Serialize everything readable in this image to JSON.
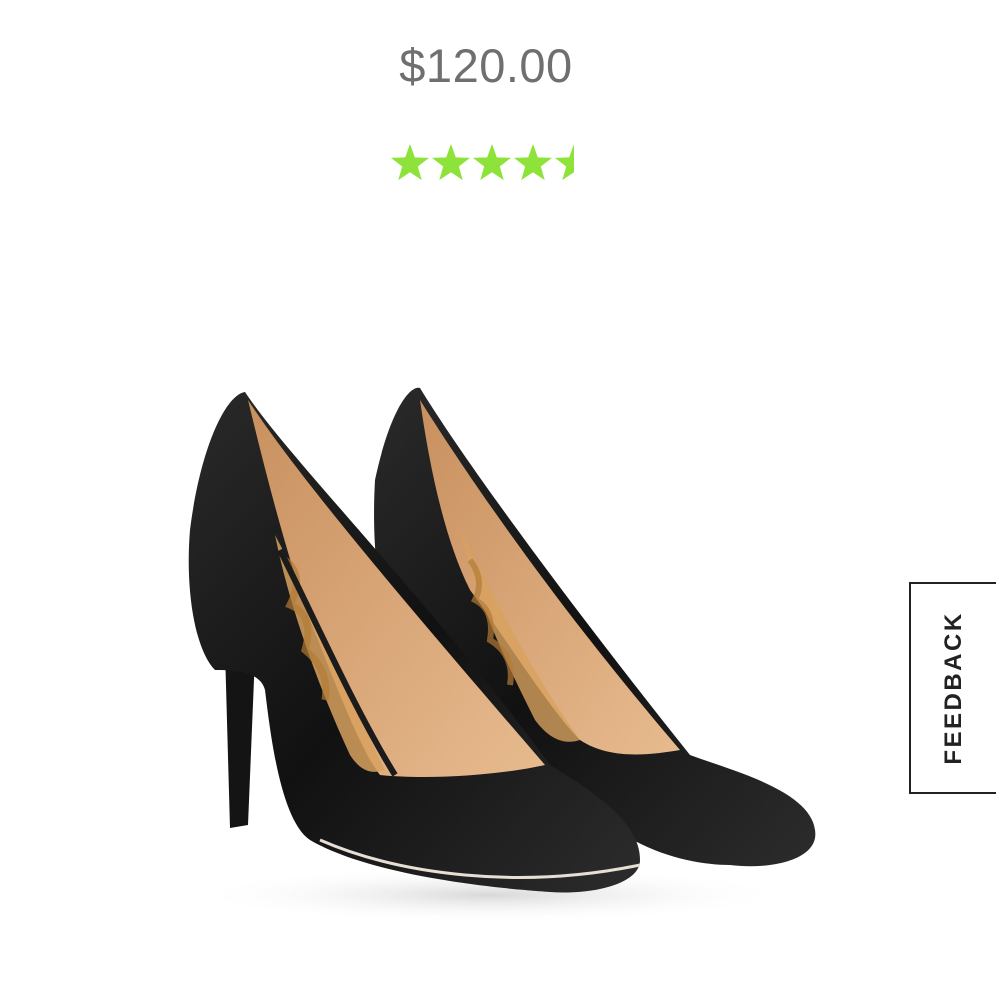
{
  "product": {
    "price": "$120.00",
    "rating": {
      "value": 4.5,
      "max": 5,
      "color": "#8ee33a"
    },
    "image_icon": "black-pointed-toe-pump-shoes"
  },
  "feedback": {
    "label": "FEEDBACK"
  }
}
